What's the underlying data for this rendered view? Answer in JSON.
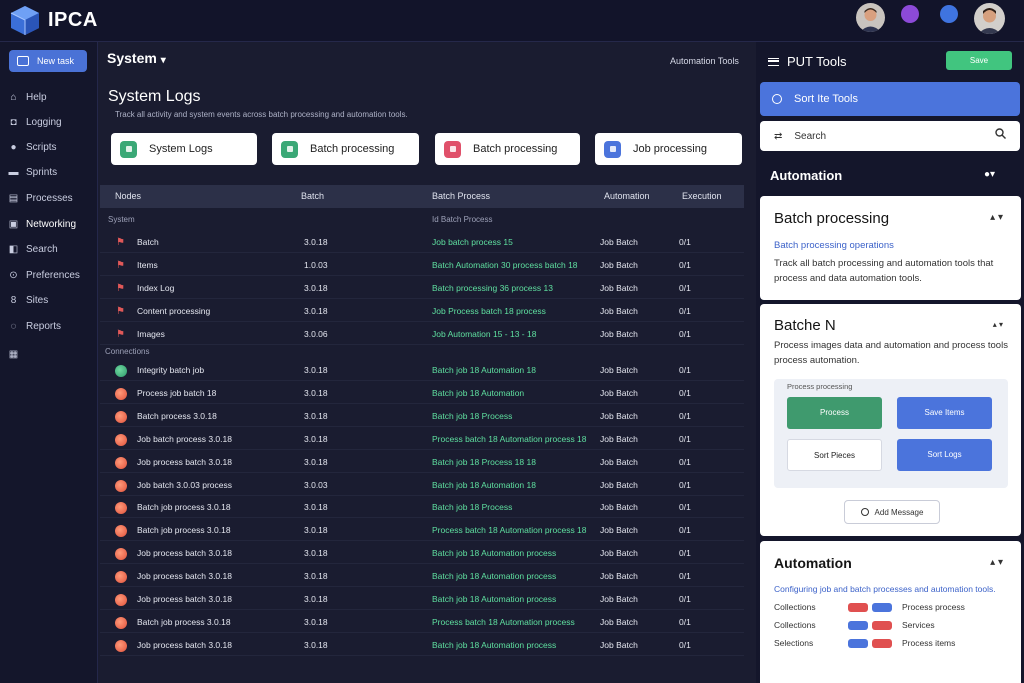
{
  "app": {
    "name": "IPCA"
  },
  "topbar": {
    "avatars": [
      "user-avatar-1",
      "status-dot-purple",
      "status-dot-blue",
      "user-avatar-2"
    ]
  },
  "sidebar": {
    "new_button": "New task",
    "items": [
      {
        "label": "Help",
        "icon": "help-icon"
      },
      {
        "label": "Logging",
        "icon": "logging-icon"
      },
      {
        "label": "Scripts",
        "icon": "scripts-icon"
      },
      {
        "label": "Sprints",
        "icon": "sprints-icon"
      },
      {
        "label": "Processes",
        "icon": "processes-icon"
      },
      {
        "label": "Networking",
        "icon": "networking-icon"
      },
      {
        "label": "Search",
        "icon": "search-icon"
      },
      {
        "label": "Preferences",
        "icon": "preferences-icon"
      },
      {
        "label": "Sites",
        "icon": "sites-icon"
      },
      {
        "label": "Reports",
        "icon": "reports-icon"
      }
    ]
  },
  "main": {
    "header": "System",
    "header_caret": "▾",
    "header_link": "Automation Tools",
    "title": "System Logs",
    "subtitle": "Track all activity and system events across batch processing and automation tools.",
    "cards": [
      {
        "label": "System Logs",
        "color": "#3aa876"
      },
      {
        "label": "Batch processing",
        "color": "#3aa876"
      },
      {
        "label": "Batch processing",
        "color": "#e0506a"
      },
      {
        "label": "Job processing",
        "color": "#4b74dc"
      }
    ],
    "table": {
      "columns": [
        "Nodes",
        "Batch",
        "Batch Process",
        "Automation",
        "Execution"
      ],
      "section1": "System",
      "section1_meta": "Id Batch Process",
      "section2": "Connections",
      "rows_a": [
        {
          "icon": "flag",
          "name": "Batch",
          "batch": "3.0.18",
          "process": "Job batch process 15",
          "auto": "Job Batch",
          "exec": "0/1"
        },
        {
          "icon": "flag",
          "name": "Items",
          "batch": "1.0.03",
          "process": "Batch Automation 30 process batch 18",
          "auto": "Job Batch",
          "exec": "0/1"
        },
        {
          "icon": "flag",
          "name": "Index Log",
          "batch": "3.0.18",
          "process": "Batch processing 36 process 13",
          "auto": "Job Batch",
          "exec": "0/1"
        },
        {
          "icon": "flag",
          "name": "Content processing",
          "batch": "3.0.18",
          "process": "Job Process batch 18 process",
          "auto": "Job Batch",
          "exec": "0/1"
        },
        {
          "icon": "flag",
          "name": "Images",
          "batch": "3.0.06",
          "process": "Job Automation 15 - 13 - 18",
          "auto": "Job Batch",
          "exec": "0/1"
        }
      ],
      "rows_b": [
        {
          "icon": "green",
          "name": "Integrity batch job",
          "batch": "3.0.18",
          "process": "Batch job 18 Automation 18",
          "auto": "Job Batch",
          "exec": "0/1"
        },
        {
          "icon": "red",
          "name": "Process job batch 18",
          "batch": "3.0.18",
          "process": "Batch job 18 Automation",
          "auto": "Job Batch",
          "exec": "0/1"
        },
        {
          "icon": "red",
          "name": "Batch process 3.0.18",
          "batch": "3.0.18",
          "process": "Batch job 18 Process",
          "auto": "Job Batch",
          "exec": "0/1"
        },
        {
          "icon": "red",
          "name": "Job batch process 3.0.18",
          "batch": "3.0.18",
          "process": "Process batch 18 Automation process 18",
          "auto": "Job Batch",
          "exec": "0/1"
        },
        {
          "icon": "red",
          "name": "Job process batch 3.0.18",
          "batch": "3.0.18",
          "process": "Batch job 18 Process 18 18",
          "auto": "Job Batch",
          "exec": "0/1"
        },
        {
          "icon": "red",
          "name": "Job batch 3.0.03 process",
          "batch": "3.0.03",
          "process": "Batch job 18 Automation 18",
          "auto": "Job Batch",
          "exec": "0/1"
        },
        {
          "icon": "red",
          "name": "Batch job process 3.0.18",
          "batch": "3.0.18",
          "process": "Batch job 18 Process",
          "auto": "Job Batch",
          "exec": "0/1"
        },
        {
          "icon": "red",
          "name": "Batch job process 3.0.18",
          "batch": "3.0.18",
          "process": "Process batch 18 Automation process 18",
          "auto": "Job Batch",
          "exec": "0/1"
        },
        {
          "icon": "red",
          "name": "Job process batch 3.0.18",
          "batch": "3.0.18",
          "process": "Batch job 18 Automation process",
          "auto": "Job Batch",
          "exec": "0/1"
        },
        {
          "icon": "red",
          "name": "Job process batch 3.0.18",
          "batch": "3.0.18",
          "process": "Batch job 18 Automation process",
          "auto": "Job Batch",
          "exec": "0/1"
        },
        {
          "icon": "red",
          "name": "Job process batch 3.0.18",
          "batch": "3.0.18",
          "process": "Batch job 18 Automation process",
          "auto": "Job Batch",
          "exec": "0/1"
        },
        {
          "icon": "red",
          "name": "Batch job process 3.0.18",
          "batch": "3.0.18",
          "process": "Process batch 18 Automation process",
          "auto": "Job Batch",
          "exec": "0/1"
        },
        {
          "icon": "red",
          "name": "Job process batch 3.0.18",
          "batch": "3.0.18",
          "process": "Batch job 18 Automation process",
          "auto": "Job Batch",
          "exec": "0/1"
        }
      ]
    }
  },
  "right": {
    "title": "PUT Tools",
    "green_button": "Save",
    "blue_button": "Sort Ite Tools",
    "search_placeholder": "Search",
    "automation_label": "Automation",
    "automation_ctrl": "▾",
    "card1": {
      "title": "Batch processing",
      "ctrl": "▴ ▾",
      "link": "Batch processing operations",
      "text": "Track all batch processing and automation tools that process and data automation tools."
    },
    "card2": {
      "title": "Batche N",
      "ctrl": "▴ ▾",
      "text": "Process images data and automation and process tools process automation.",
      "panel_label": "Process processing",
      "buttons": [
        {
          "label": "Process",
          "color": "#3f9a6e"
        },
        {
          "label": "Save Items",
          "color": "#4b74dc"
        },
        {
          "label": "Sort Pieces",
          "color": "#ffffff"
        },
        {
          "label": "Sort Logs",
          "color": "#4b74dc"
        }
      ],
      "outline_button": "Add Message"
    },
    "card3": {
      "title": "Automation",
      "ctrl": "▴ ▾",
      "link": "Configuring job and batch processes and automation tools.",
      "rows": [
        {
          "label": "Collections",
          "pill1": "#e05050",
          "pill2": "#4b74dc",
          "text": "Process process"
        },
        {
          "label": "Collections",
          "pill1": "#4b74dc",
          "pill2": "#e05050",
          "text": "Services"
        },
        {
          "label": "Selections",
          "pill1": "#4b74dc",
          "pill2": "#e05050",
          "text": "Process items"
        }
      ]
    }
  }
}
